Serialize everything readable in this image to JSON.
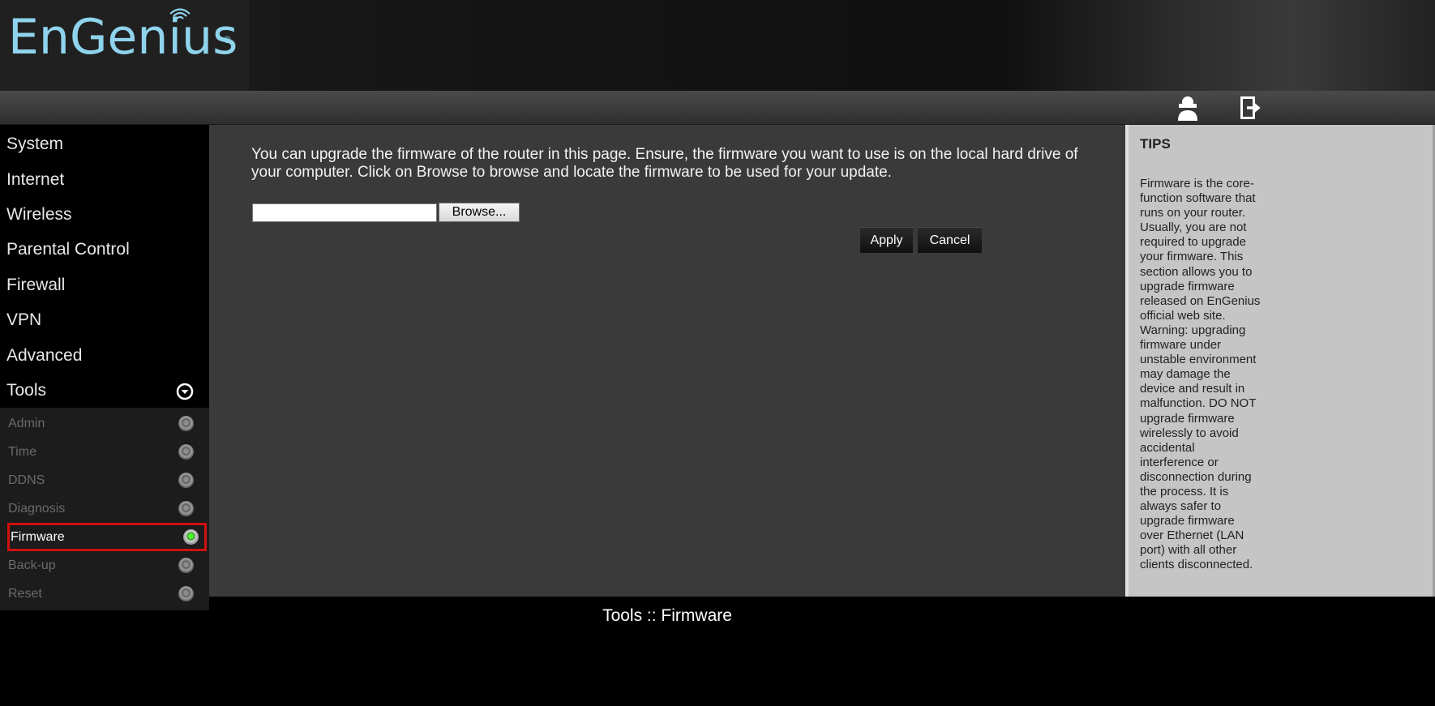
{
  "brand": {
    "name": "EnGenius",
    "registered": "®"
  },
  "toolbar": {
    "user_icon": "user-icon",
    "logout_icon": "logout-icon"
  },
  "menu": {
    "items": [
      "System",
      "Internet",
      "Wireless",
      "Parental Control",
      "Firewall",
      "VPN",
      "Advanced",
      "Tools"
    ],
    "expanded": "Tools",
    "tools_submenu": [
      "Admin",
      "Time",
      "DDNS",
      "Diagnosis",
      "Firmware",
      "Back-up",
      "Reset"
    ],
    "active": "Firmware"
  },
  "main": {
    "description": "You can upgrade the firmware of the router in this page. Ensure, the firmware you want to use is on the local hard drive of your computer. Click on Browse to browse and locate the firmware to be used for your update.",
    "file_value": "",
    "browse_label": "Browse...",
    "apply_label": "Apply",
    "cancel_label": "Cancel"
  },
  "tips": {
    "title": "TIPS",
    "body": "Firmware is the core-function software that runs on your router. Usually, you are not required to upgrade your firmware. This section allows you to upgrade firmware released on EnGenius official web site. Warning: upgrading firmware under unstable environment may damage the device and result in malfunction. DO NOT upgrade firmware wirelessly to avoid accidental interference or disconnection during the process. It is always safer to upgrade firmware over Ethernet (LAN port) with all other clients disconnected."
  },
  "footer": {
    "title": "Tools :: Firmware"
  },
  "colors": {
    "logo": "#8fd3ec",
    "active_outline": "#d01010",
    "active_dot": "#4cff2a",
    "content_bg": "#3a3a3a",
    "tips_bg": "#c5c5c5"
  }
}
